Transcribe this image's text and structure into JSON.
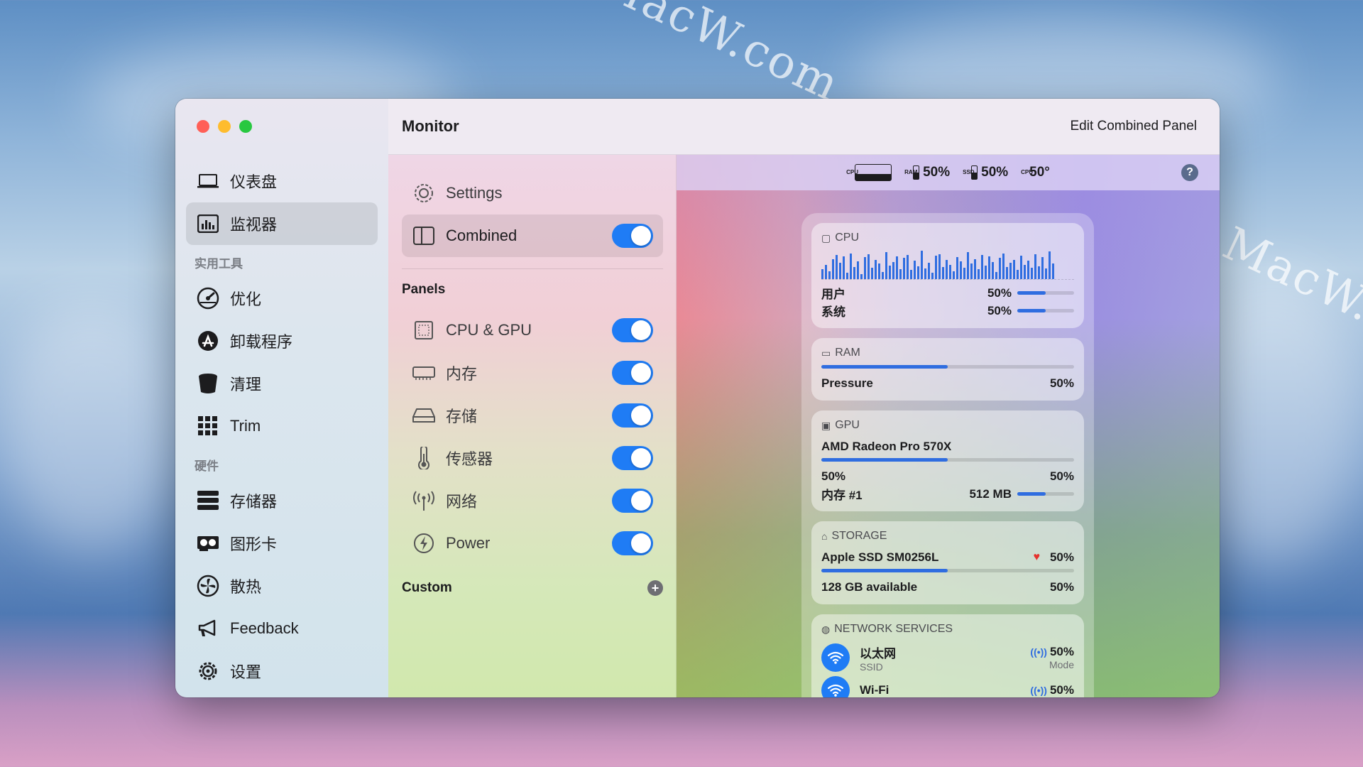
{
  "watermark": "MacW.com",
  "window": {
    "sidebar": {
      "items_top": [
        {
          "label": "仪表盘",
          "icon": "laptop-icon"
        },
        {
          "label": "监视器",
          "icon": "monitor-chart-icon",
          "active": true
        }
      ],
      "section_tools": "实用工具",
      "items_tools": [
        {
          "label": "优化",
          "icon": "gauge-icon"
        },
        {
          "label": "卸载程序",
          "icon": "app-store-icon"
        },
        {
          "label": "清理",
          "icon": "bucket-icon"
        },
        {
          "label": "Trim",
          "icon": "grid-icon"
        }
      ],
      "section_hw": "硬件",
      "items_hw": [
        {
          "label": "存储器",
          "icon": "storage-icon"
        },
        {
          "label": "图形卡",
          "icon": "gpu-card-icon"
        },
        {
          "label": "散热",
          "icon": "fan-icon"
        },
        {
          "label": "Feedback",
          "icon": "megaphone-icon"
        },
        {
          "label": "设置",
          "icon": "gear-icon"
        }
      ]
    },
    "titlebar": {
      "title": "Monitor",
      "edit_label": "Edit Combined Panel"
    },
    "middle": {
      "settings_label": "Settings",
      "combined_label": "Combined",
      "panels_title": "Panels",
      "panels": [
        {
          "label": "CPU & GPU",
          "icon": "cpu-icon",
          "enabled": true
        },
        {
          "label": "内存",
          "icon": "memory-icon",
          "enabled": true
        },
        {
          "label": "存储",
          "icon": "drive-icon",
          "enabled": true
        },
        {
          "label": "传感器",
          "icon": "thermometer-icon",
          "enabled": true
        },
        {
          "label": "网络",
          "icon": "antenna-icon",
          "enabled": true
        },
        {
          "label": "Power",
          "icon": "power-icon",
          "enabled": true
        }
      ],
      "custom_title": "Custom"
    },
    "menubar": {
      "cpu_tag": "CPU",
      "ram_tag": "RAM",
      "ram_value": "50%",
      "ssd_tag": "SSD",
      "ssd_value": "50%",
      "temp_tag": "CPU",
      "temp_value": "50°"
    },
    "combined_panel": {
      "cpu": {
        "header": "CPU",
        "user_label": "用户",
        "user_value": "50%",
        "user_fill": 0.5,
        "system_label": "系统",
        "system_value": "50%",
        "system_fill": 0.5,
        "graph": [
          12,
          18,
          10,
          25,
          30,
          20,
          28,
          8,
          32,
          15,
          22,
          6,
          27,
          31,
          14,
          24,
          19,
          9,
          33,
          17,
          21,
          28,
          12,
          26,
          30,
          11,
          23,
          16,
          35,
          13,
          20,
          8,
          29,
          31,
          15,
          24,
          18,
          10,
          27,
          22,
          14,
          33,
          19,
          25,
          12,
          30,
          17,
          28,
          21,
          9,
          26,
          32,
          15,
          20,
          24,
          11,
          29,
          18,
          23,
          14,
          31,
          16,
          27,
          13,
          34,
          19
        ]
      },
      "ram": {
        "header": "RAM",
        "pressure_label": "Pressure",
        "pressure_value": "50%",
        "fill": 0.5
      },
      "gpu": {
        "header": "GPU",
        "name": "AMD Radeon Pro 570X",
        "usage_left": "50%",
        "usage_right": "50%",
        "fill": 0.5,
        "mem_label": "内存 #1",
        "mem_value": "512 MB",
        "mem_fill": 0.5
      },
      "storage": {
        "header": "STORAGE",
        "name": "Apple SSD SM0256L",
        "value": "50%",
        "fill": 0.5,
        "available_label": "128 GB available",
        "available_value": "50%"
      },
      "network": {
        "header": "NETWORK SERVICES",
        "items": [
          {
            "name": "以太网",
            "sub": "SSID",
            "value": "50%",
            "mode": "Mode"
          },
          {
            "name": "Wi-Fi",
            "value": "50%"
          }
        ]
      }
    }
  }
}
